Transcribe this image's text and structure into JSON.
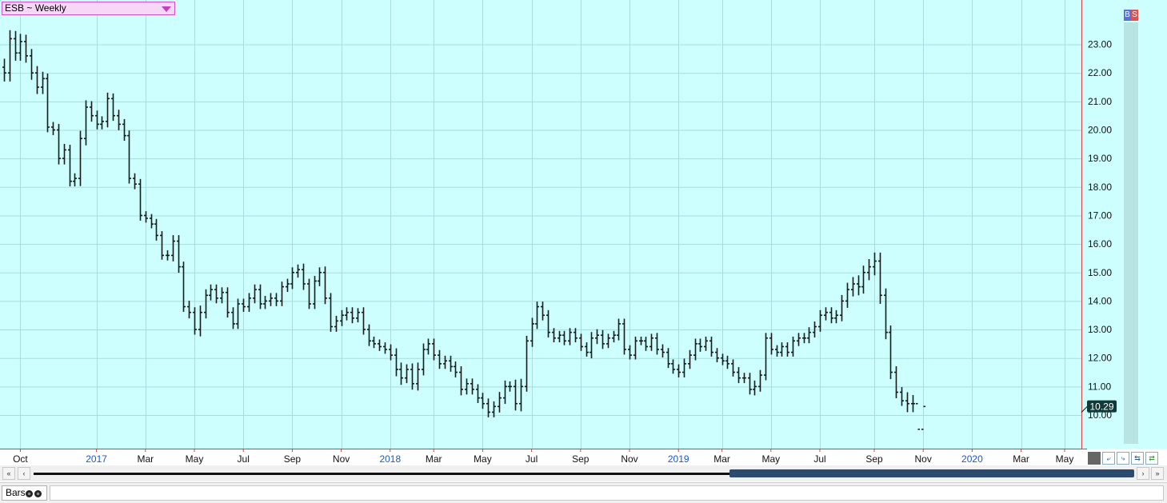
{
  "chart_data": {
    "type": "ohlc",
    "symbol_label": "ESB ~ Weekly",
    "ylim": [
      9.0,
      24.9
    ],
    "yticks": [
      10,
      11,
      12,
      13,
      14,
      15,
      16,
      17,
      18,
      19,
      20,
      21,
      22,
      23
    ],
    "ytick_labels": [
      "10.00",
      "11.00",
      "12.00",
      "13.00",
      "14.00",
      "15.00",
      "16.00",
      "17.00",
      "18.00",
      "19.00",
      "20.00",
      "21.00",
      "22.00",
      "23.00"
    ],
    "last_price_label": "10.29",
    "last_price": 10.29,
    "x_labels": [
      {
        "label": "Oct",
        "bar": 3,
        "year": false
      },
      {
        "label": "2017",
        "bar": 17,
        "year": true
      },
      {
        "label": "Mar",
        "bar": 26,
        "year": false
      },
      {
        "label": "May",
        "bar": 35,
        "year": false
      },
      {
        "label": "Jul",
        "bar": 44,
        "year": false
      },
      {
        "label": "Sep",
        "bar": 53,
        "year": false
      },
      {
        "label": "Nov",
        "bar": 62,
        "year": false
      },
      {
        "label": "2018",
        "bar": 71,
        "year": true
      },
      {
        "label": "Mar",
        "bar": 79,
        "year": false
      },
      {
        "label": "May",
        "bar": 88,
        "year": false
      },
      {
        "label": "Jul",
        "bar": 97,
        "year": false
      },
      {
        "label": "Sep",
        "bar": 106,
        "year": false
      },
      {
        "label": "Nov",
        "bar": 115,
        "year": false
      },
      {
        "label": "2019",
        "bar": 124,
        "year": true
      },
      {
        "label": "Mar",
        "bar": 132,
        "year": false
      },
      {
        "label": "May",
        "bar": 141,
        "year": false
      },
      {
        "label": "Jul",
        "bar": 150,
        "year": false
      },
      {
        "label": "Sep",
        "bar": 160,
        "year": false
      },
      {
        "label": "Nov",
        "bar": 169,
        "year": false
      },
      {
        "label": "2020",
        "bar": 178,
        "year": true
      },
      {
        "label": "Mar",
        "bar": 187,
        "year": false
      },
      {
        "label": "May",
        "bar": 195,
        "year": false
      }
    ],
    "closes": [
      22.0,
      23.2,
      22.7,
      23.1,
      22.6,
      22.0,
      21.5,
      21.8,
      20.1,
      20.0,
      19.0,
      19.3,
      18.2,
      18.3,
      19.7,
      20.8,
      20.5,
      20.2,
      20.3,
      21.1,
      20.5,
      20.2,
      19.8,
      18.3,
      18.1,
      17.0,
      16.9,
      16.7,
      16.3,
      15.6,
      15.6,
      16.1,
      15.2,
      13.8,
      13.6,
      13.0,
      13.6,
      14.2,
      14.4,
      14.1,
      14.3,
      13.6,
      13.2,
      13.9,
      13.8,
      14.1,
      14.4,
      13.9,
      14.0,
      14.1,
      14.0,
      14.5,
      14.6,
      15.0,
      15.1,
      14.6,
      13.9,
      14.7,
      15.0,
      14.1,
      13.1,
      13.3,
      13.5,
      13.6,
      13.4,
      13.6,
      13.0,
      12.6,
      12.5,
      12.4,
      12.3,
      12.1,
      11.6,
      11.3,
      11.6,
      11.1,
      11.6,
      12.3,
      12.5,
      12.1,
      11.8,
      11.9,
      11.7,
      11.5,
      10.9,
      11.1,
      10.9,
      10.6,
      10.4,
      10.1,
      10.3,
      10.6,
      11.0,
      11.0,
      10.4,
      11.0,
      12.6,
      13.2,
      13.8,
      13.5,
      12.9,
      12.7,
      12.8,
      12.6,
      12.9,
      12.7,
      12.4,
      12.2,
      12.7,
      12.8,
      12.5,
      12.7,
      12.8,
      13.2,
      12.3,
      12.1,
      12.6,
      12.6,
      12.4,
      12.7,
      12.3,
      12.2,
      11.8,
      11.6,
      11.5,
      11.8,
      12.1,
      12.5,
      12.4,
      12.6,
      12.2,
      12.0,
      11.9,
      11.8,
      11.5,
      11.3,
      11.3,
      10.9,
      11.0,
      11.4,
      12.7,
      12.3,
      12.2,
      12.4,
      12.2,
      12.6,
      12.7,
      12.7,
      12.9,
      13.1,
      13.5,
      13.6,
      13.4,
      13.5,
      14.0,
      14.4,
      14.6,
      14.5,
      15.0,
      15.2,
      15.4,
      14.2,
      12.9,
      11.5,
      10.8,
      10.5,
      10.4,
      10.4,
      9.5,
      10.3
    ],
    "bar_half_ranges": [
      0.5,
      0.5,
      0.45,
      0.45,
      0.4,
      0.4,
      0.4,
      0.4,
      0.3,
      0.3,
      0.35,
      0.35,
      0.3,
      0.3,
      0.45,
      0.4,
      0.35,
      0.3,
      0.3,
      0.35,
      0.3,
      0.35,
      0.3,
      0.3,
      0.3,
      0.3,
      0.25,
      0.25,
      0.3,
      0.25,
      0.3,
      0.35,
      0.35,
      0.3,
      0.35,
      0.3,
      0.4,
      0.35,
      0.3,
      0.3,
      0.3,
      0.3,
      0.3,
      0.3,
      0.3,
      0.3,
      0.3,
      0.3,
      0.3,
      0.3,
      0.3,
      0.3,
      0.3,
      0.3,
      0.3,
      0.35,
      0.3,
      0.3,
      0.3,
      0.35,
      0.3,
      0.3,
      0.3,
      0.3,
      0.3,
      0.25,
      0.3,
      0.3,
      0.25,
      0.25,
      0.25,
      0.3,
      0.4,
      0.4,
      0.3,
      0.35,
      0.4,
      0.35,
      0.3,
      0.3,
      0.3,
      0.3,
      0.3,
      0.3,
      0.35,
      0.3,
      0.3,
      0.3,
      0.3,
      0.3,
      0.3,
      0.35,
      0.35,
      0.3,
      0.4,
      0.45,
      0.3,
      0.35,
      0.3,
      0.3,
      0.3,
      0.25,
      0.25,
      0.25,
      0.25,
      0.25,
      0.25,
      0.25,
      0.35,
      0.35,
      0.3,
      0.25,
      0.25,
      0.3,
      0.3,
      0.25,
      0.25,
      0.25,
      0.25,
      0.25,
      0.3,
      0.3,
      0.25,
      0.25,
      0.3,
      0.3,
      0.3,
      0.3,
      0.3,
      0.25,
      0.25,
      0.25,
      0.25,
      0.3,
      0.25,
      0.3,
      0.3,
      0.3,
      0.35,
      0.3,
      0.3,
      0.3,
      0.25,
      0.25,
      0.25,
      0.25,
      0.3,
      0.3,
      0.3,
      0.3,
      0.3,
      0.3,
      0.3,
      0.3,
      0.35,
      0.4,
      0.4,
      0.5,
      0.4,
      0.45,
      0.5,
      0.5,
      0.4,
      0.4,
      0.35,
      0.3,
      0.5,
      0.5
    ],
    "colors": {
      "background": "#ccfffd",
      "grid": "#a8dde0",
      "bars": "#1a1a1a",
      "axis_line": "#d04040",
      "price_tag": "#103a3a",
      "year_label": "#1c58c8",
      "buy_tag": "#5a70d8",
      "sell_tag": "#e05050"
    }
  },
  "controls": {
    "buy_label": "B",
    "sell_label": "S",
    "scroll_left_far": "«",
    "scroll_left": "‹",
    "scroll_right": "›",
    "scroll_right_far": "»"
  },
  "status": {
    "mode_label": "Bars"
  }
}
